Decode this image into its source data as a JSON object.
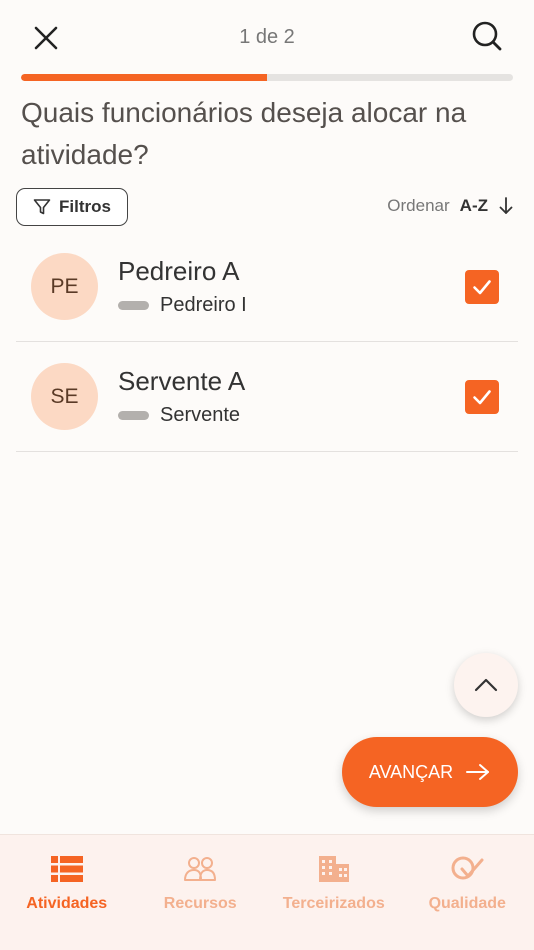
{
  "header": {
    "step": "1 de 2",
    "progress": 0.5
  },
  "question": "Quais funcionários deseja alocar na atividade?",
  "filters": {
    "label": "Filtros"
  },
  "sort": {
    "label": "Ordenar",
    "value": "A-Z"
  },
  "employees": [
    {
      "initials": "PE",
      "name": "Pedreiro A",
      "role": "Pedreiro I",
      "checked": true
    },
    {
      "initials": "SE",
      "name": "Servente A",
      "role": "Servente",
      "checked": true
    }
  ],
  "advance_button": {
    "label": "AVANÇAR"
  },
  "tabs": [
    {
      "label": "Atividades",
      "icon": "list-icon",
      "active": true
    },
    {
      "label": "Recursos",
      "icon": "people-icon",
      "active": false
    },
    {
      "label": "Terceirizados",
      "icon": "building-icon",
      "active": false
    },
    {
      "label": "Qualidade",
      "icon": "quality-icon",
      "active": false
    }
  ],
  "colors": {
    "accent": "#f56423",
    "avatar_bg": "#fcd9c4",
    "tab_inactive": "#f3b08e",
    "tabbar_bg": "#fdf2ee"
  }
}
